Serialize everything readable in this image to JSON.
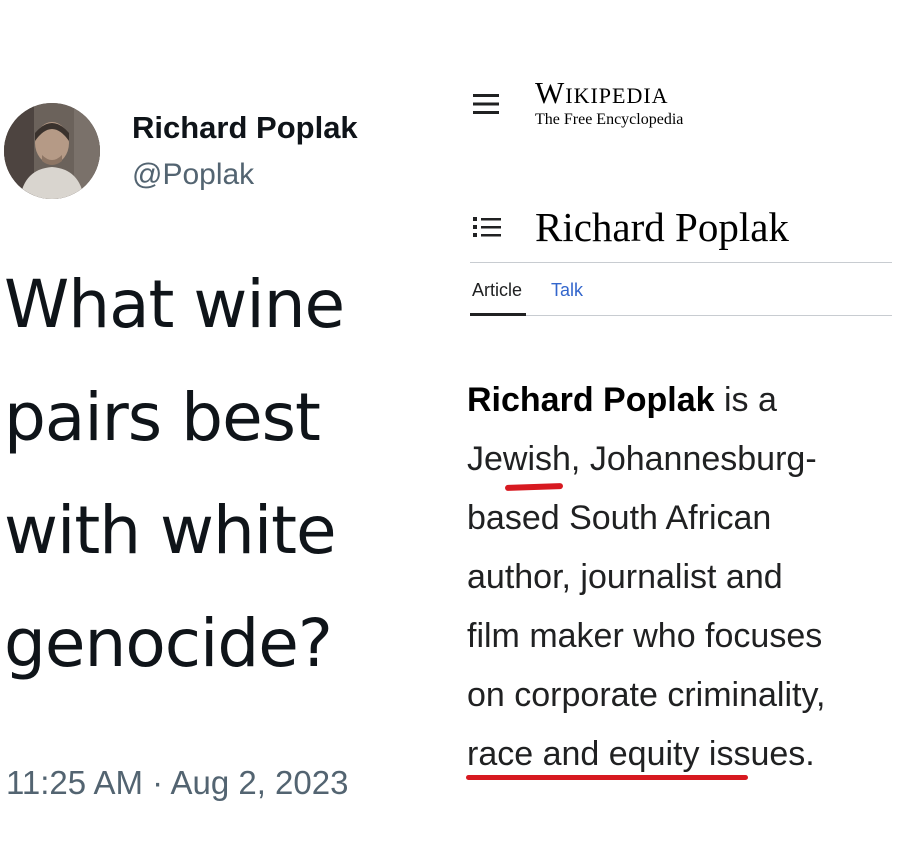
{
  "tweet": {
    "author_name": "Richard Poplak",
    "author_handle": "@Poplak",
    "text_lines": [
      "What wine",
      "pairs best",
      "with white",
      "genocide?"
    ],
    "timestamp": "11:25 AM · Aug 2, 2023"
  },
  "wikipedia": {
    "wordmark": "Wikipedia",
    "tagline": "The Free Encyclopedia",
    "title": "Richard Poplak",
    "tabs": [
      {
        "label": "Article",
        "active": true
      },
      {
        "label": "Talk",
        "active": false
      }
    ],
    "body": {
      "line1_bold": "Richard Poplak",
      "line1_rest": " is a",
      "line2": "Jewish, Johannesburg-",
      "line3": "based South African",
      "line4": "author, journalist and",
      "line5": "film maker who focuses",
      "line6": "on corporate criminality,",
      "line7": "race and equity issues."
    },
    "annotation_color": "#d71920",
    "link_color": "#3366cc"
  }
}
